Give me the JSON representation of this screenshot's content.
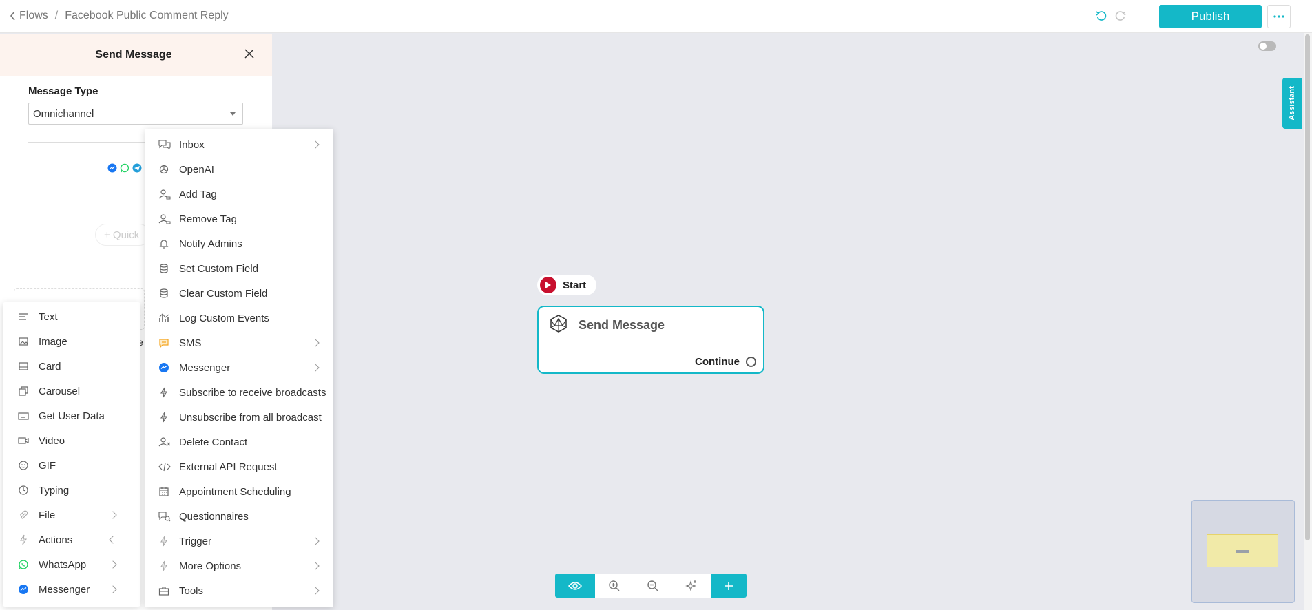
{
  "header": {
    "breadcrumb_root": "Flows",
    "breadcrumb_sep": "/",
    "flow_name": "Facebook Public Comment Reply",
    "publish_label": "Publish"
  },
  "canvas": {
    "assistant_label": "Assistant",
    "start_label": "Start",
    "node_title": "Send Message",
    "node_continue": "Continue"
  },
  "panel": {
    "title": "Send Message",
    "message_type_label": "Message Type",
    "message_type_value": "Omnichannel",
    "quick_reply_stub": "+ Quick",
    "stub_letter": "e"
  },
  "menu_left": [
    {
      "label": "Text",
      "icon": "text-icon"
    },
    {
      "label": "Image",
      "icon": "image-icon"
    },
    {
      "label": "Card",
      "icon": "card-icon"
    },
    {
      "label": "Carousel",
      "icon": "carousel-icon"
    },
    {
      "label": "Get User Data",
      "icon": "keyboard-icon"
    },
    {
      "label": "Video",
      "icon": "video-icon"
    },
    {
      "label": "GIF",
      "icon": "gif-icon"
    },
    {
      "label": "Typing",
      "icon": "clock-icon"
    },
    {
      "label": "File",
      "icon": "paperclip-icon"
    },
    {
      "label": "Actions",
      "icon": "bolt-icon"
    },
    {
      "label": "WhatsApp",
      "icon": "whatsapp-icon"
    },
    {
      "label": "Messenger",
      "icon": "messenger-icon"
    }
  ],
  "menu_right": [
    {
      "label": "Inbox",
      "icon": "chat-icon"
    },
    {
      "label": "OpenAI",
      "icon": "openai-icon"
    },
    {
      "label": "Add Tag",
      "icon": "user-tag-icon"
    },
    {
      "label": "Remove Tag",
      "icon": "user-tag-icon"
    },
    {
      "label": "Notify Admins",
      "icon": "bell-icon"
    },
    {
      "label": "Set Custom Field",
      "icon": "database-icon"
    },
    {
      "label": "Clear Custom Field",
      "icon": "database-icon"
    },
    {
      "label": "Log Custom Events",
      "icon": "chart-icon"
    },
    {
      "label": "SMS",
      "icon": "sms-icon"
    },
    {
      "label": "Messenger",
      "icon": "messenger-icon"
    },
    {
      "label": "Subscribe to receive broadcasts",
      "icon": "bolt-icon"
    },
    {
      "label": "Unsubscribe from all broadcast",
      "icon": "bolt-icon"
    },
    {
      "label": "Delete Contact",
      "icon": "user-remove-icon"
    },
    {
      "label": "External API Request",
      "icon": "code-icon"
    },
    {
      "label": "Appointment Scheduling",
      "icon": "calendar-icon"
    },
    {
      "label": "Questionnaires",
      "icon": "questionnaire-icon"
    },
    {
      "label": "Trigger",
      "icon": "bolt-icon"
    },
    {
      "label": "More Options",
      "icon": "bolt-icon"
    },
    {
      "label": "Tools",
      "icon": "briefcase-icon"
    }
  ],
  "colors": {
    "accent": "#14b8c8",
    "start_red": "#c8102e",
    "messenger_blue": "#1877f2",
    "whatsapp_green": "#25d366",
    "sms_orange": "#f5a623"
  }
}
